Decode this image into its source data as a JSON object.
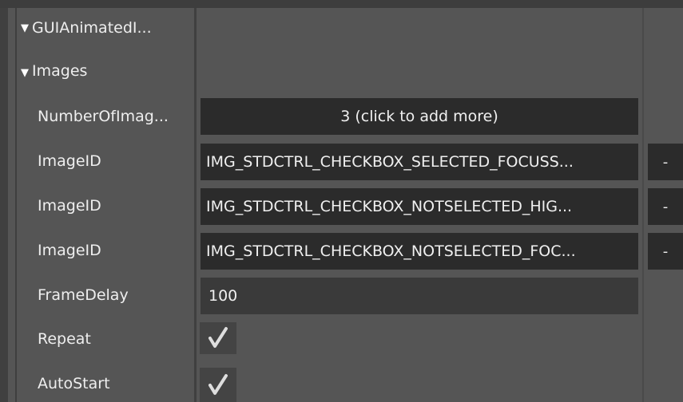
{
  "tree": {
    "group1": "GUIAnimatedI...",
    "group2": "Images"
  },
  "fields": {
    "number_of_images_label": "NumberOfImag...",
    "number_of_images_value": "3 (click to add more)",
    "images": [
      {
        "label": "ImageID",
        "value": "IMG_STDCTRL_CHECKBOX_SELECTED_FOCUSS...",
        "remove": "-"
      },
      {
        "label": "ImageID",
        "value": "IMG_STDCTRL_CHECKBOX_NOTSELECTED_HIG...",
        "remove": "-"
      },
      {
        "label": "ImageID",
        "value": "IMG_STDCTRL_CHECKBOX_NOTSELECTED_FOC...",
        "remove": "-"
      }
    ],
    "frame_delay_label": "FrameDelay",
    "frame_delay_value": "100",
    "repeat_label": "Repeat",
    "repeat_checked": true,
    "autostart_label": "AutoStart",
    "autostart_checked": true
  },
  "colors": {
    "panel_bg": "#555555",
    "field_bg": "#2b2b2b",
    "check": "#dedede"
  },
  "icons": {
    "expand": "triangle-down-icon",
    "check": "checkmark-icon"
  }
}
